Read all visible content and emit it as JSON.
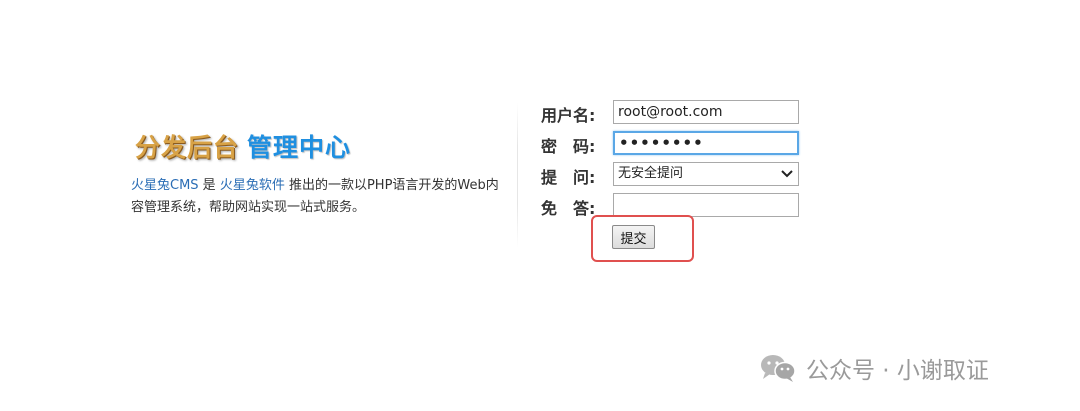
{
  "brand": {
    "title_part1": "分发后台",
    "title_part2": "管理中心",
    "desc_link1": "火星兔CMS",
    "desc_text1": " 是 ",
    "desc_link2": "火星兔软件",
    "desc_text2": " 推出的一款以PHP语言开发的Web内容管理系统，帮助网站实现一站式服务。"
  },
  "form": {
    "username_label": "用户名:",
    "username_value": "root@root.com",
    "password_label": "密　码:",
    "password_value": "••••••••",
    "question_label": "提　问:",
    "question_selected": "无安全提问",
    "answer_label": "免　答:",
    "answer_value": "",
    "submit_label": "提交"
  },
  "watermark": {
    "text": "公众号 · 小谢取证",
    "icon": "wechat-icon"
  },
  "colors": {
    "highlight_border": "#e0504f",
    "focus_border": "#5aa7e6",
    "link": "#2a6db5",
    "title_gold": "#d8a246",
    "title_blue": "#1f8fe0"
  }
}
